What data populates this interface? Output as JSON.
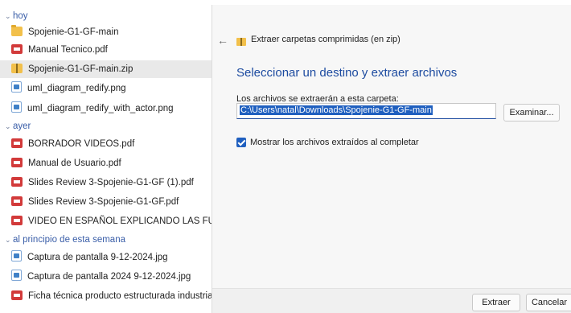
{
  "explorer": {
    "groups": [
      {
        "label": "hoy"
      },
      {
        "label": "ayer"
      },
      {
        "label": "al principio de esta semana"
      }
    ],
    "files": [
      {
        "name": "Spojenie-G1-GF-main",
        "icon": "folder-icon"
      },
      {
        "name": "Manual Tecnico.pdf",
        "icon": "pdf-icon"
      },
      {
        "name": "Spojenie-G1-GF-main.zip",
        "icon": "zip-folder-icon"
      },
      {
        "name": "uml_diagram_redify.png",
        "icon": "image-icon"
      },
      {
        "name": "uml_diagram_redify_with_actor.png",
        "icon": "image-icon"
      },
      {
        "name": "BORRADOR VIDEOS.pdf",
        "icon": "pdf-icon"
      },
      {
        "name": "Manual de Usuario.pdf",
        "icon": "pdf-icon"
      },
      {
        "name": "Slides Review 3-Spojenie-G1-GF (1).pdf",
        "icon": "pdf-icon"
      },
      {
        "name": "Slides Review 3-Spojenie-G1-GF.pdf",
        "icon": "pdf-icon"
      },
      {
        "name": "VIDEO EN ESPAÑOL EXPLICANDO LAS FUNCIONALID",
        "icon": "pdf-icon"
      },
      {
        "name": "Captura de pantalla 9-12-2024.jpg",
        "icon": "image-icon"
      },
      {
        "name": "Captura de pantalla 2024 9-12-2024.jpg",
        "icon": "image-icon"
      },
      {
        "name": "Ficha técnica producto estructurada industria gris azu",
        "icon": "pdf-icon"
      }
    ]
  },
  "dialog": {
    "title": "Extraer carpetas comprimidas (en zip)",
    "heading": "Seleccionar un destino y extraer archivos",
    "field_label": "Los archivos se extraerán a esta carpeta:",
    "path_value": "C:\\Users\\natal\\Downloads\\Spojenie-G1-GF-main",
    "browse_label": "Examinar...",
    "checkbox_label": "Mostrar los archivos extraídos al completar",
    "checkbox_checked": true,
    "extract_label": "Extraer",
    "cancel_label": "Cancelar"
  },
  "colors": {
    "accent": "#1f5fbf",
    "heading": "#1d4ba0",
    "group_header": "#3a5ea8",
    "selected_row": "#e9e9e9"
  }
}
